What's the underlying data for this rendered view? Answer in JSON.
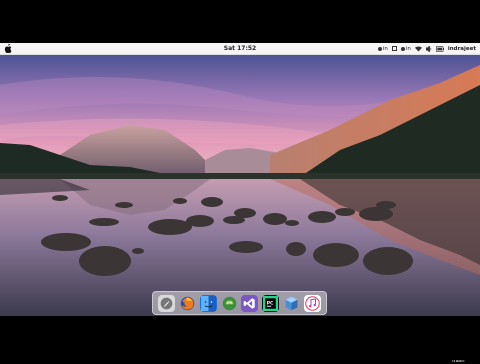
{
  "menubar": {
    "clock": "Sat 17:52",
    "kb_layout_1": "in",
    "kb_layout_2": "in",
    "username": "indrajeet"
  },
  "dock": {
    "apps": [
      "launcher-icon",
      "firefox-icon",
      "finder-icon",
      "android-studio-icon",
      "visual-studio-icon",
      "pycharm-icon",
      "virtualbox-icon",
      "itunes-icon"
    ]
  },
  "desktop": {
    "trash_label": "Trash"
  },
  "colors": {
    "menubar_bg": "#f5f5f5",
    "sky_top": "#5a5f9e",
    "sky_pink": "#d98bb2",
    "water": "#9a7fa0"
  }
}
